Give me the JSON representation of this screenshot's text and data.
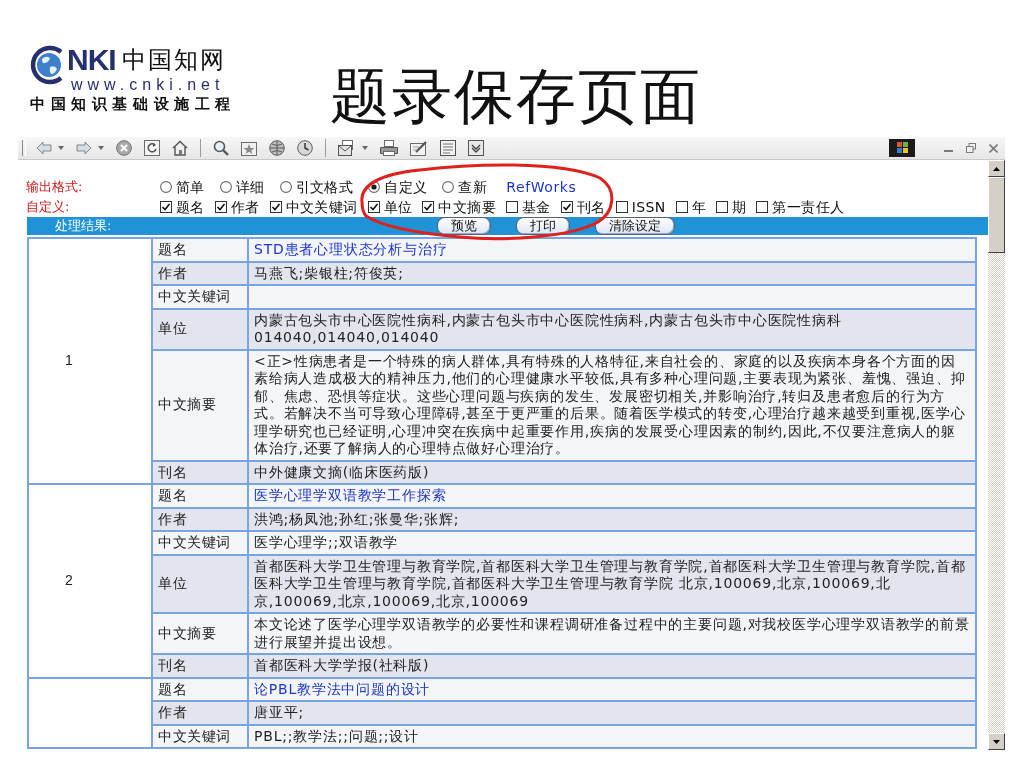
{
  "logo": {
    "wordmark": "NKI",
    "name": "中国知网",
    "url": "www.cnki.net",
    "tagline": "中国知识基础设施工程"
  },
  "slide_title": "题录保存页面",
  "options": {
    "format_label": "输出格式:",
    "formats": [
      {
        "label": "简单",
        "selected": false
      },
      {
        "label": "详细",
        "selected": false
      },
      {
        "label": "引文格式",
        "selected": false
      },
      {
        "label": "自定义",
        "selected": true
      },
      {
        "label": "查新",
        "selected": false
      }
    ],
    "export_link": "RefWorks",
    "custom_label": "自定义:",
    "fields": [
      {
        "label": "题名",
        "checked": true
      },
      {
        "label": "作者",
        "checked": true
      },
      {
        "label": "中文关键词",
        "checked": true
      },
      {
        "label": "单位",
        "checked": true
      },
      {
        "label": "中文摘要",
        "checked": true
      },
      {
        "label": "基金",
        "checked": false
      },
      {
        "label": "刊名",
        "checked": true
      },
      {
        "label": "ISSN",
        "checked": false
      },
      {
        "label": "年",
        "checked": false
      },
      {
        "label": "期",
        "checked": false
      },
      {
        "label": "第一责任人",
        "checked": false
      }
    ]
  },
  "result_bar": {
    "label": "处理结果:",
    "buttons": [
      "预览",
      "打印",
      "清除设定"
    ]
  },
  "records": [
    {
      "number": "1",
      "fields": [
        {
          "label": "题名",
          "kind": "link",
          "value": "STD患者心理状态分析与治疗"
        },
        {
          "label": "作者",
          "kind": "text",
          "value": "马燕飞;柴银柱;符俊英;"
        },
        {
          "label": "中文关键词",
          "kind": "text"
        },
        {
          "label": "单位",
          "kind": "text",
          "value": "内蒙古包头市中心医院性病科,内蒙古包头市中心医院性病科,内蒙古包头市中心医院性病科 014040,014040,014040"
        },
        {
          "label": "中文摘要",
          "kind": "text",
          "value": "<正>性病患者是一个特殊的病人群体,具有特殊的人格特征,来自社会的、家庭的以及疾病本身各个方面的因素给病人造成极大的精神压力,他们的心理健康水平较低,具有多种心理问题,主要表现为紧张、羞愧、强迫、抑郁、焦虑、恐惧等症状。这些心理问题与疾病的发生、发展密切相关,并影响治疗,转归及患者愈后的行为方式。若解决不当可导致心理障碍,甚至于更严重的后果。随着医学模式的转变,心理治疗越来越受到重视,医学心理学研究也已经证明,心理冲突在疾病中起重要作用,疾病的发展受心理因素的制约,因此,不仅要注意病人的躯体治疗,还要了解病人的心理特点做好心理治疗。"
        },
        {
          "label": "刊名",
          "kind": "text",
          "value": "中外健康文摘(临床医药版)"
        }
      ]
    },
    {
      "number": "2",
      "fields": [
        {
          "label": "题名",
          "kind": "link",
          "value": "医学心理学双语教学工作探索"
        },
        {
          "label": "作者",
          "kind": "text",
          "value": "洪鸿;杨凤池;孙红;张曼华;张辉;"
        },
        {
          "label": "中文关键词",
          "kind": "text",
          "value": "医学心理学;;双语教学"
        },
        {
          "label": "单位",
          "kind": "text",
          "value": "首都医科大学卫生管理与教育学院,首都医科大学卫生管理与教育学院,首都医科大学卫生管理与教育学院,首都医科大学卫生管理与教育学院,首都医科大学卫生管理与教育学院 北京,100069,北京,100069,北京,100069,北京,100069,北京,100069"
        },
        {
          "label": "中文摘要",
          "kind": "text",
          "value": "本文论述了医学心理学双语教学的必要性和课程调研准备过程中的主要问题,对我校医学心理学双语教学的前景进行展望并提出设想。"
        },
        {
          "label": "刊名",
          "kind": "text",
          "value": "首都医科大学学报(社科版)"
        }
      ]
    },
    {
      "fields": [
        {
          "label": "题名",
          "kind": "link",
          "value": "论PBL教学法中问题的设计"
        },
        {
          "label": "作者",
          "kind": "text",
          "value": "唐亚平;"
        },
        {
          "label": "中文关键词",
          "kind": "text",
          "value": "PBL;;教学法;;问题;;设计"
        }
      ]
    }
  ]
}
